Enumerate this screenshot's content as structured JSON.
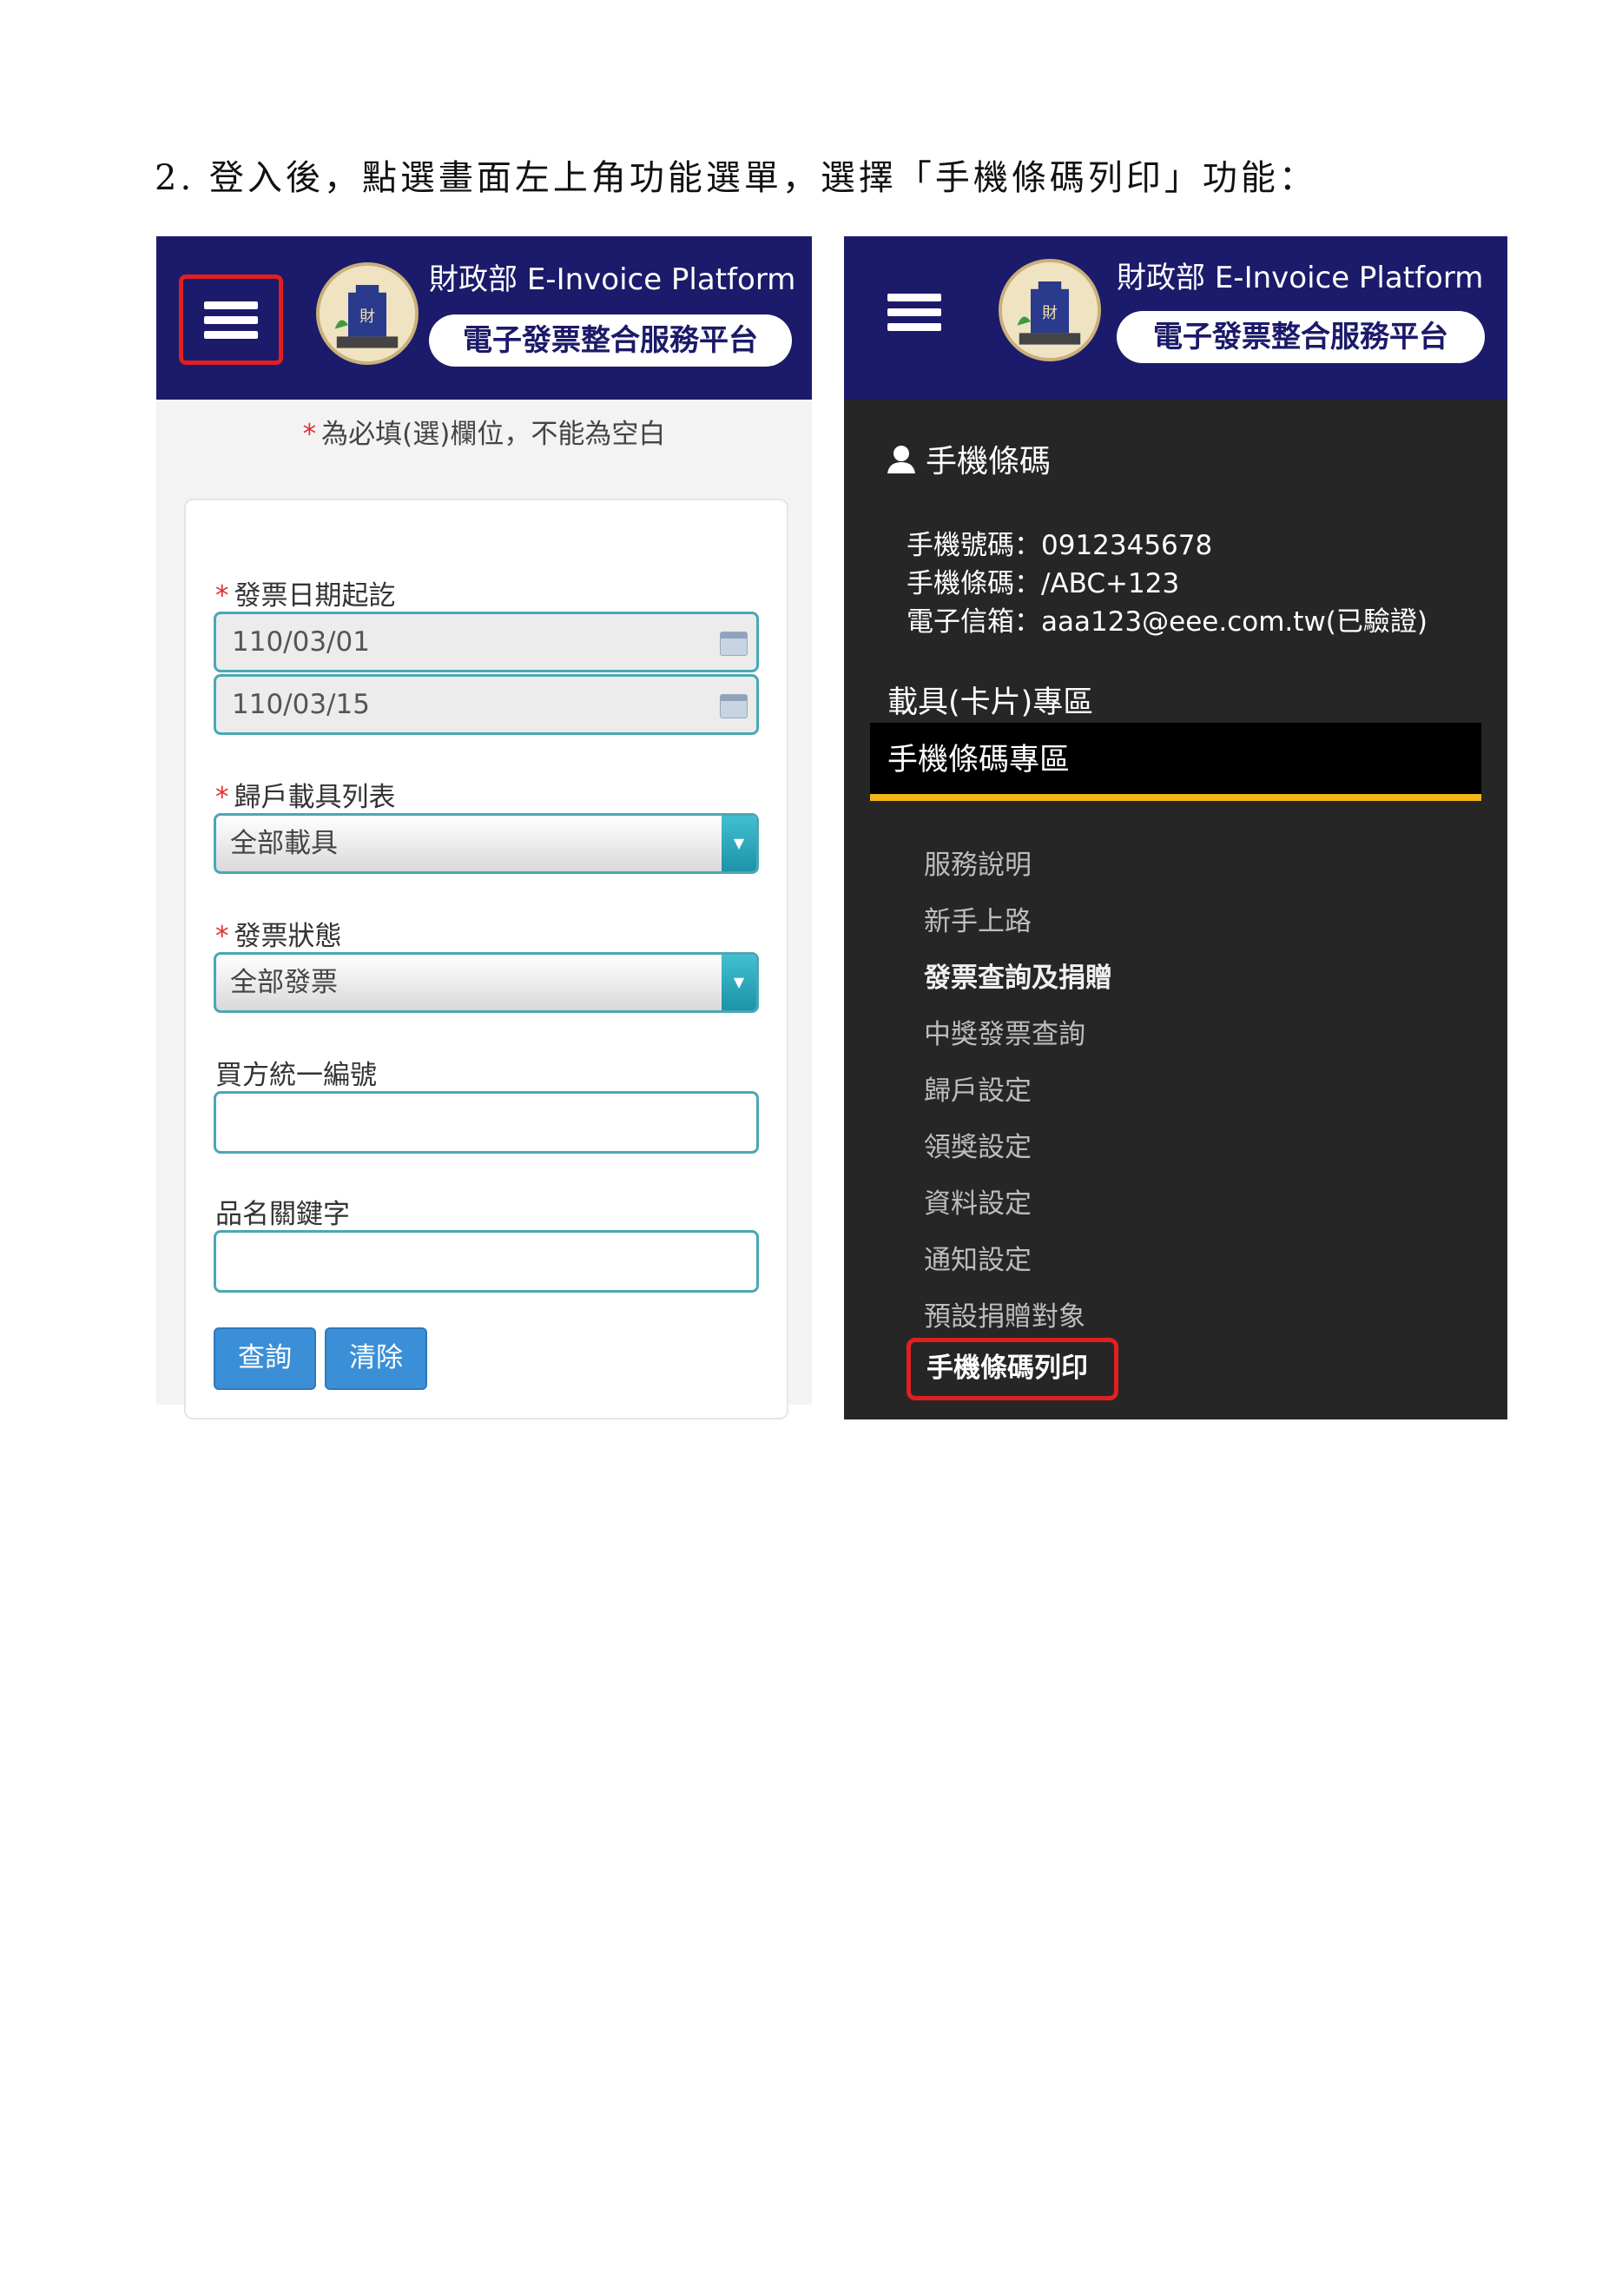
{
  "caption": "2. 登入後，點選畫面左上角功能選單，選擇「手機條碼列印」功能：",
  "header": {
    "title_zh": "財政部",
    "title_en": "E-Invoice Platform",
    "subtitle": "電子發票整合服務平台",
    "logo_glyph": "財"
  },
  "left": {
    "required_note": "為必填(選)欄位，不能為空白",
    "required_mark": "*",
    "invoice_date_label": "發票日期起訖",
    "date_start": "110/03/01",
    "date_end": "110/03/15",
    "carrier_label": "歸戶載具列表",
    "carrier_value": "全部載具",
    "status_label": "發票狀態",
    "status_value": "全部發票",
    "buyer_id_label": "買方統一編號",
    "keyword_label": "品名關鍵字",
    "query_button": "查詢",
    "clear_button": "清除"
  },
  "right": {
    "profile_title": "手機條碼",
    "phone_line": "手機號碼：0912345678",
    "barcode_line": "手機條碼：/ABC+123",
    "email_line": "電子信箱：aaa123@eee.com.tw(已驗證)",
    "section_card": "載具(卡片)專區",
    "section_mobile": "手機條碼專區",
    "menu": [
      "服務說明",
      "新手上路",
      "發票查詢及捐贈",
      "中獎發票查詢",
      "歸戶設定",
      "領獎設定",
      "資料設定",
      "通知設定",
      "預設捐贈對象"
    ],
    "menu_print": "手機條碼列印"
  },
  "colors": {
    "header_bg": "#1c1a6a",
    "dark_panel": "#262626",
    "accent_bar": "#f2b618",
    "highlight": "#e02020",
    "button_blue": "#3b8fd6",
    "input_border": "#4aa8b4"
  }
}
